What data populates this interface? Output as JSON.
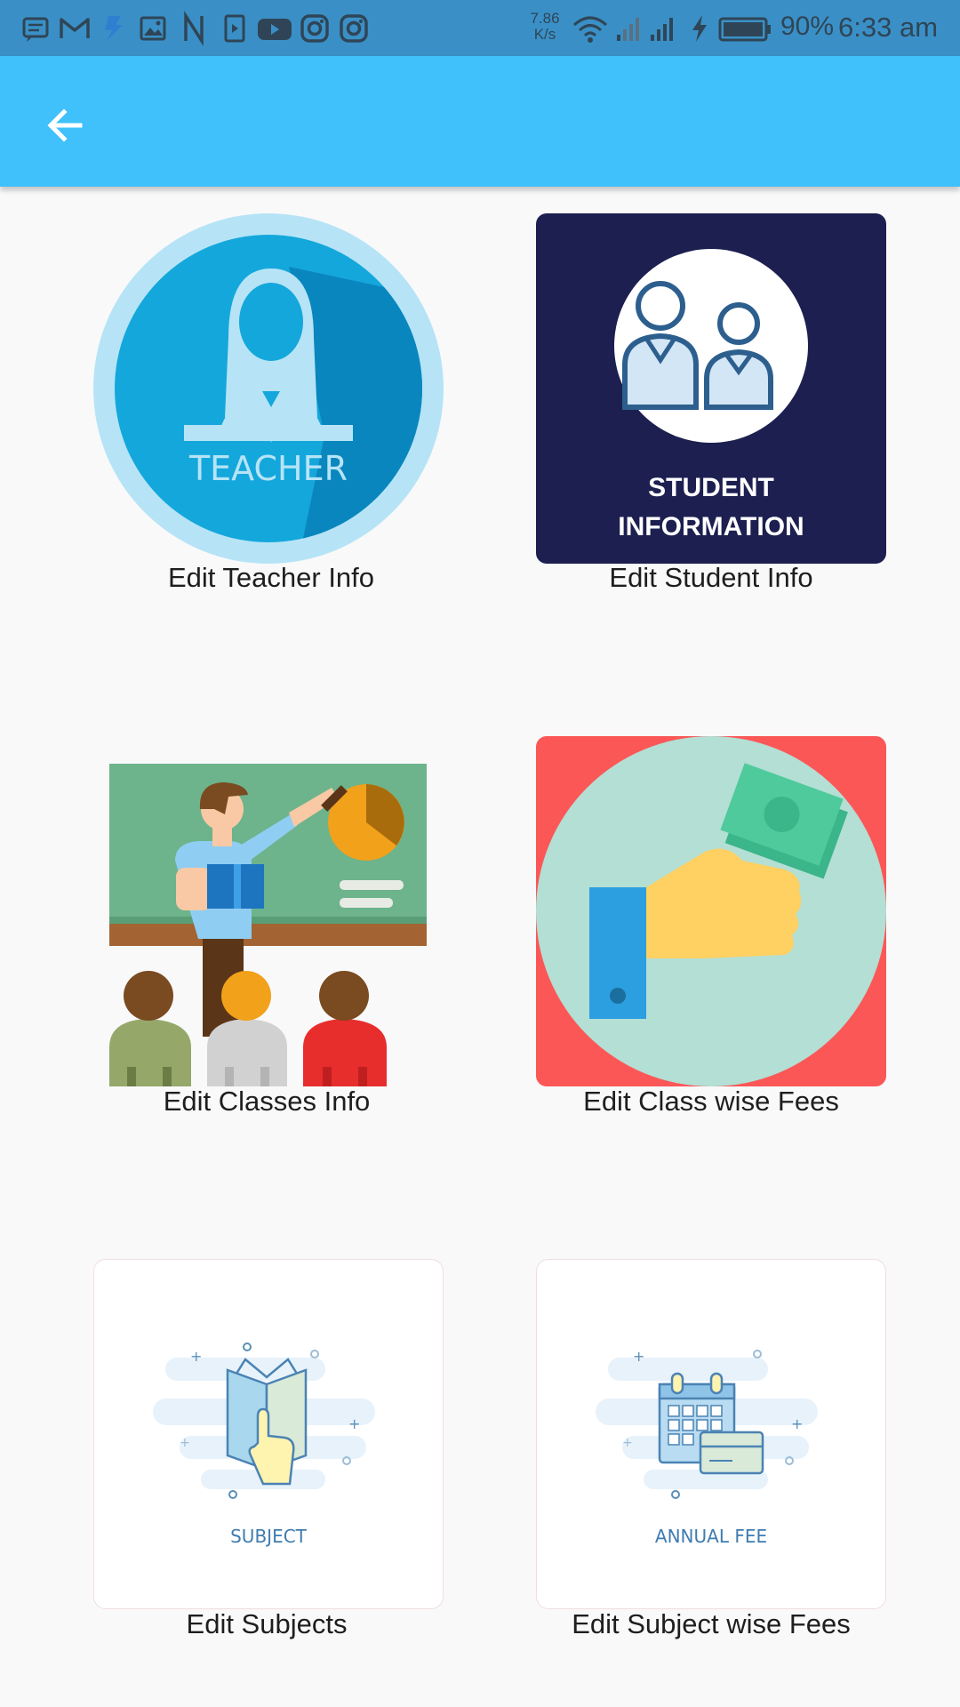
{
  "status_bar": {
    "notification_icons": [
      "message-icon",
      "gmail-icon",
      "bolt-app-icon",
      "gallery-icon",
      "netflix-icon",
      "play-store-icon",
      "youtube-icon",
      "instagram-icon",
      "instagram-icon"
    ],
    "net_speed_value": "7.86",
    "net_speed_unit": "K/s",
    "battery_percent": "90%",
    "time": "6:33 am"
  },
  "app_bar": {
    "back_icon": "arrow-back-icon",
    "color": "#40c1fc"
  },
  "tiles": [
    {
      "label": "Edit Teacher Info",
      "image_text": "TEACHER"
    },
    {
      "label": "Edit Student Info",
      "image_text_line1": "STUDENT",
      "image_text_line2": "INFORMATION"
    },
    {
      "label": "Edit Classes Info"
    },
    {
      "label": "Edit Class wise Fees"
    },
    {
      "label": "Edit Subjects",
      "image_text": "SUBJECT"
    },
    {
      "label": "Edit Subject wise Fees",
      "image_text": "ANNUAL FEE"
    }
  ]
}
